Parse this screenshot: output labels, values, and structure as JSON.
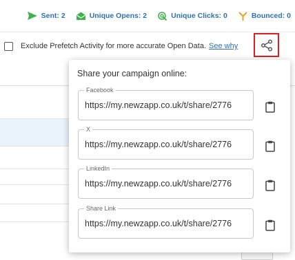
{
  "stats": {
    "sent": "Sent: 2",
    "unique_opens": "Unique Opens: 2",
    "unique_clicks": "Unique Clicks: 0",
    "bounced": "Bounced: 0"
  },
  "prefetch": {
    "label": "Exclude Prefetch Activity for more accurate Open Data.",
    "link": "See why",
    "checked": false
  },
  "share_popup": {
    "title": "Share your campaign online:",
    "fields": [
      {
        "label": "Facebook",
        "value": "https://my.newzapp.co.uk/t/share/2776"
      },
      {
        "label": "X",
        "value": "https://my.newzapp.co.uk/t/share/2776"
      },
      {
        "label": "LinkedIn",
        "value": "https://my.newzapp.co.uk/t/share/2776"
      },
      {
        "label": "Share Link",
        "value": "https://my.newzapp.co.uk/t/share/2776"
      }
    ]
  },
  "icons": {
    "sent": "send-icon",
    "opens": "envelope-open-icon",
    "clicks": "cursor-click-icon",
    "bounced": "bounce-icon",
    "share": "share-icon",
    "copy": "clipboard-icon"
  },
  "colors": {
    "stat_text": "#2f6fb5",
    "sent_icon": "#3cb44b",
    "opens_icon": "#3cb44b",
    "clicks_icon": "#3cb44b",
    "bounced_icon": "#f0a020",
    "highlight_border": "#e01b24",
    "link": "#2f6fb5"
  }
}
